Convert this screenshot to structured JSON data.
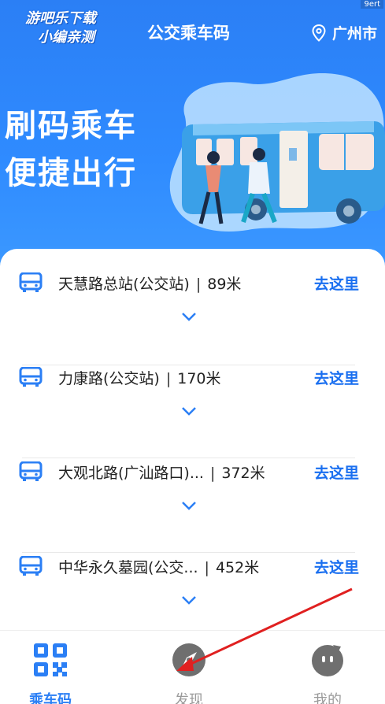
{
  "watermark": {
    "line1": "游吧乐下载",
    "line2": "小编亲测"
  },
  "status_tag": "9ert",
  "header": {
    "title": "公交乘车码",
    "city": "广州市",
    "slogan_line1": "刷码乘车",
    "slogan_line2": "便捷出行"
  },
  "stops": [
    {
      "name": "天慧路总站(公交站)",
      "distance": "89米",
      "action": "去这里"
    },
    {
      "name": "力康路(公交站)",
      "distance": "170米",
      "action": "去这里"
    },
    {
      "name": "大观北路(广汕路口)...",
      "distance": "372米",
      "action": "去这里"
    },
    {
      "name": "中华永久墓园(公交...",
      "distance": "452米",
      "action": "去这里"
    }
  ],
  "tabs": [
    {
      "label": "乘车码",
      "icon": "qr-code-icon",
      "active": true
    },
    {
      "label": "发现",
      "icon": "discover-icon",
      "active": false
    },
    {
      "label": "我的",
      "icon": "profile-icon",
      "active": false
    }
  ],
  "colors": {
    "primary": "#2b7ff5",
    "link": "#1a6ff0",
    "annotation_arrow": "#e02020"
  }
}
